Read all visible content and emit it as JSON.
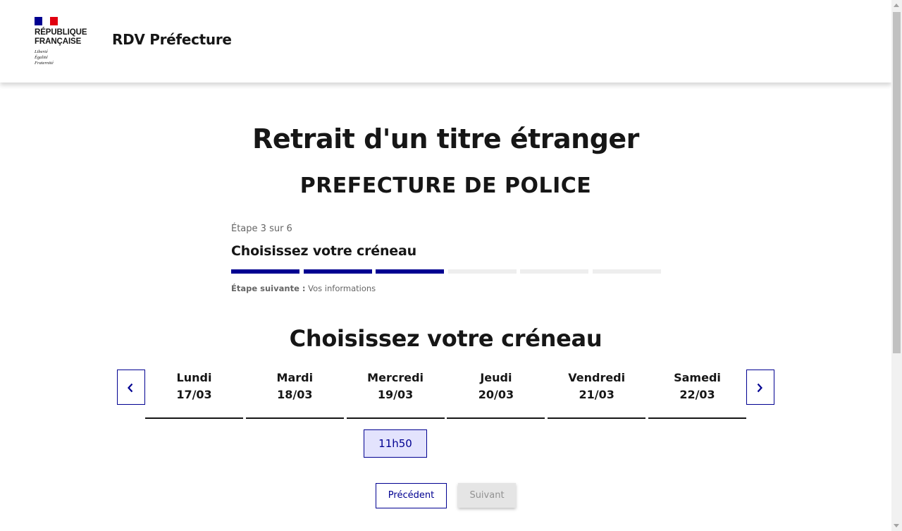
{
  "header": {
    "logo": {
      "republic_text": "RÉPUBLIQUE\nFRANÇAISE",
      "motto": "Liberté\nÉgalité\nFraternité",
      "flag_colors": [
        "#000091",
        "#ffffff",
        "#e1000f"
      ]
    },
    "site_title": "RDV Préfecture"
  },
  "main": {
    "title": "Retrait d'un titre étranger",
    "prefecture": "PREFECTURE DE POLICE",
    "stepper": {
      "state": "Étape 3 sur 6",
      "title": "Choisissez votre créneau",
      "current_step": 3,
      "total_steps": 6,
      "next_label": "Étape suivante :",
      "next_value": "Vos informations",
      "colors": {
        "done": "#000091",
        "todo": "#eeeeee"
      }
    },
    "slot_section_title": "Choisissez votre créneau",
    "calendar": {
      "prev_icon": "chevron-left-icon",
      "next_icon": "chevron-right-icon",
      "days": [
        {
          "name": "Lundi",
          "date": "17/03"
        },
        {
          "name": "Mardi",
          "date": "18/03"
        },
        {
          "name": "Mercredi",
          "date": "19/03"
        },
        {
          "name": "Jeudi",
          "date": "20/03"
        },
        {
          "name": "Vendredi",
          "date": "21/03"
        },
        {
          "name": "Samedi",
          "date": "22/03"
        }
      ],
      "slots": [
        {
          "day_index": 2,
          "time": "11h50"
        }
      ]
    },
    "buttons": {
      "previous": "Précédent",
      "next": "Suivant",
      "next_disabled": true
    }
  }
}
